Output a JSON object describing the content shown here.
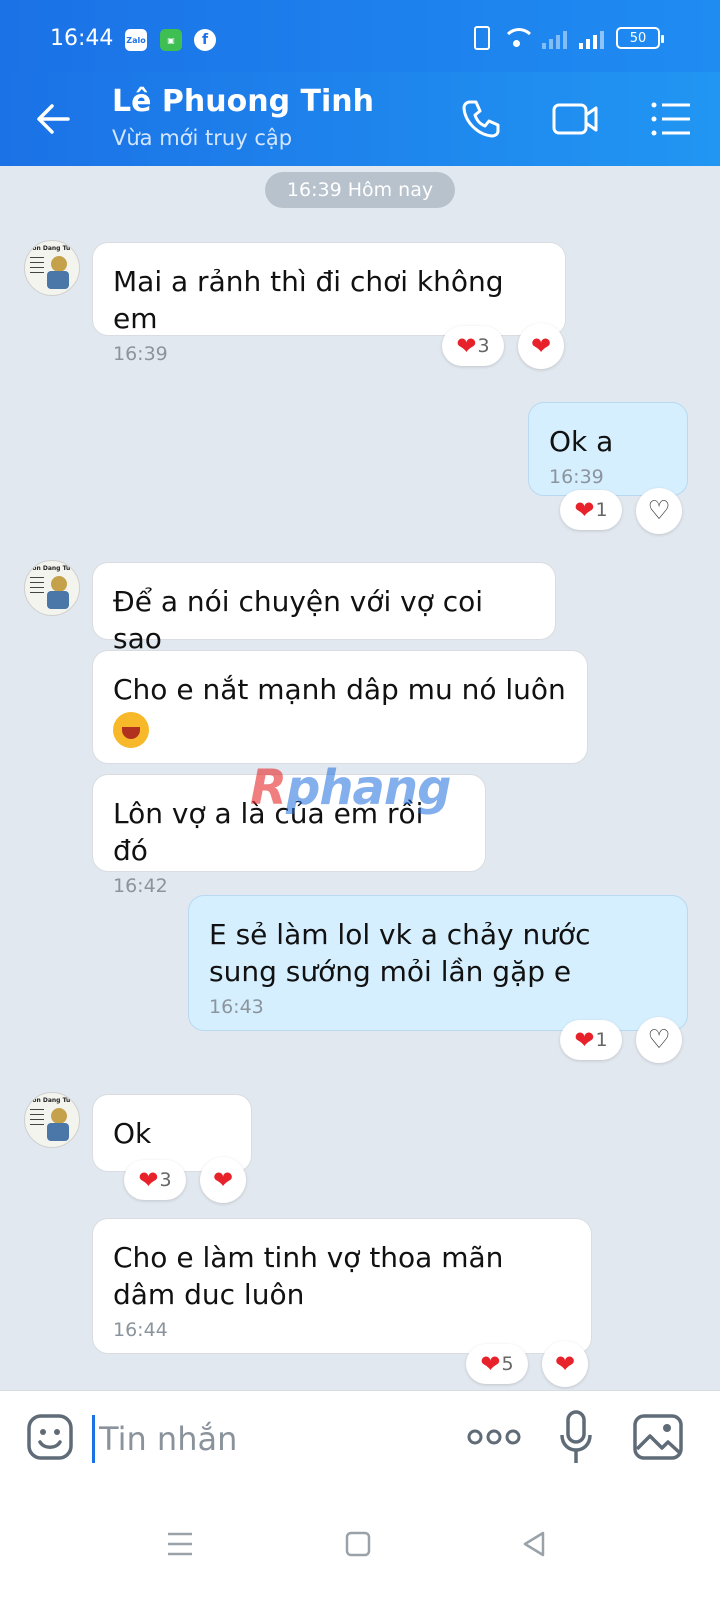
{
  "status_bar": {
    "time": "16:44",
    "app_icons": [
      "zalo-icon",
      "app-icon",
      "facebook-icon"
    ],
    "zalo_label": "Zalo",
    "battery": "50"
  },
  "header": {
    "contact_name": "Lê Phuong Tinh",
    "contact_status": "Vừa mới truy cập",
    "accent_color": "#1b72e6"
  },
  "chat": {
    "date_chip": "16:39 Hôm nay",
    "messages": [
      {
        "dir": "in",
        "text": "Mai a rảnh thì đi chơi không em",
        "time": "16:39",
        "reaction_count": "3"
      },
      {
        "dir": "out",
        "text": "Ok a",
        "time": "16:39",
        "reaction_count": "1"
      },
      {
        "dir": "in",
        "text": "Để a nói chuyện với vợ coi sao"
      },
      {
        "dir": "in",
        "text": "Cho e nắt mạnh dâp mu nó luôn"
      },
      {
        "dir": "in",
        "text": "Lôn vợ a là của em rồi đó",
        "time": "16:42"
      },
      {
        "dir": "out",
        "text": "E sẻ làm lol vk a chảy nước sung sướng mỏi lần gặp e",
        "time": "16:43",
        "reaction_count": "1"
      },
      {
        "dir": "in",
        "text": "Ok",
        "reaction_count": "3"
      },
      {
        "dir": "in",
        "text": "Cho e làm tinh vợ thoa mãn dâm duc luôn",
        "time": "16:44",
        "reaction_count": "5"
      }
    ]
  },
  "watermark": {
    "part1": "R",
    "part2": "phang"
  },
  "input_bar": {
    "placeholder": "Tin nhắn"
  }
}
